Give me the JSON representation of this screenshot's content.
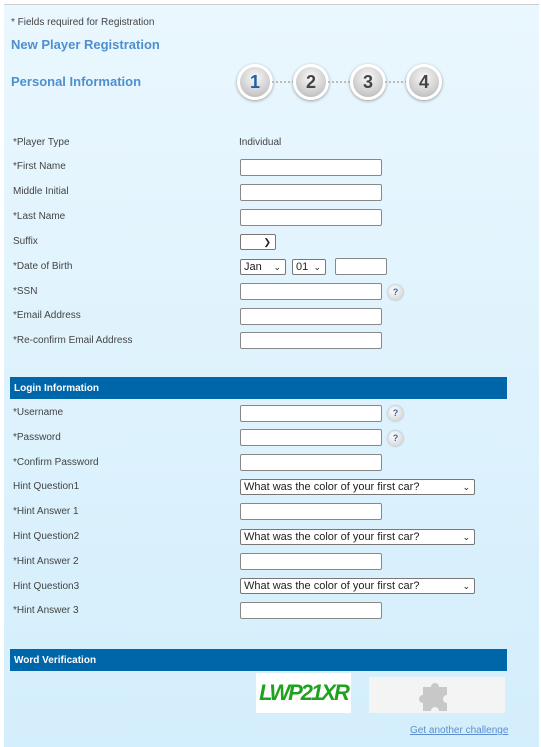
{
  "note": "* Fields required for Registration",
  "title": "New Player Registration",
  "section": "Personal Information",
  "steps": [
    "1",
    "2",
    "3",
    "4"
  ],
  "personal": [
    {
      "label": "*Player Type",
      "value": "Individual"
    },
    {
      "label": "*First Name",
      "value": ""
    },
    {
      "label": "Middle Initial",
      "value": ""
    },
    {
      "label": "*Last Name",
      "value": ""
    },
    {
      "label": "Suffix",
      "value": ""
    },
    {
      "label": "*Date of Birth",
      "month": "Jan",
      "day": "01",
      "year": ""
    },
    {
      "label": "*SSN",
      "value": ""
    },
    {
      "label": "*Email Address",
      "value": ""
    },
    {
      "label": "*Re-confirm Email Address",
      "value": ""
    }
  ],
  "login": {
    "header": "Login Information",
    "fields": [
      {
        "label": "*Username"
      },
      {
        "label": "*Password"
      },
      {
        "label": "*Confirm Password"
      },
      {
        "label": "Hint Question1",
        "value": "What was the color of your first car?"
      },
      {
        "label": "*Hint Answer 1"
      },
      {
        "label": "Hint Question2",
        "value": "What was the color of your first car?"
      },
      {
        "label": "*Hint Answer 2"
      },
      {
        "label": "Hint Question3",
        "value": "What was the color of your first car?"
      },
      {
        "label": "*Hint Answer 3"
      }
    ]
  },
  "verification": {
    "header": "Word Verification",
    "captcha": "LWP21XR",
    "link": "Get another challenge"
  },
  "help_glyph": "?",
  "colors": {
    "accent": "#4f8fd0",
    "bar": "#0066aa",
    "captcha": "#1fa21f"
  }
}
